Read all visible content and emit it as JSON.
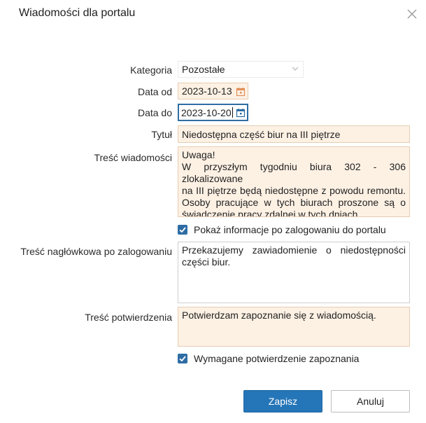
{
  "dialog": {
    "title": "Wiadomości dla portalu"
  },
  "form": {
    "kategoria": {
      "label": "Kategoria",
      "value": "Pozostałe"
    },
    "data_od": {
      "label": "Data od",
      "value": "2023-10-13"
    },
    "data_do": {
      "label": "Data do",
      "value": "2023-10-20"
    },
    "tytul": {
      "label": "Tytuł",
      "value": "Niedostępna część biur na III piętrze"
    },
    "tresc_wiadomosci": {
      "label": "Treść wiadomości",
      "lines": [
        "Uwaga!",
        "W przyszłym tygodniu biura 302 - 306 zlokalizowane",
        "na III piętrze będą niedostępne z powodu remontu.",
        "Osoby pracujące w tych biurach proszone są o",
        "świadczenie pracy zdalnej w tych dniach."
      ]
    },
    "pokaz_informacje": {
      "label": "Pokaż informacje po zalogowaniu do portalu",
      "checked": true
    },
    "tresc_naglowkowa": {
      "label": "Treść nagłówkowa po zalogowaniu",
      "lines": [
        "Przekazujemy zawiadomienie o niedostępności",
        "części biur."
      ]
    },
    "tresc_potwierdzenia": {
      "label": "Treść potwierdzenia",
      "value": "Potwierdzam zapoznanie się z wiadomością."
    },
    "wymagane_potwierdzenie": {
      "label": "Wymagane potwierdzenie zapoznania",
      "checked": true
    }
  },
  "buttons": {
    "save": "Zapisz",
    "cancel": "Anuluj"
  },
  "colors": {
    "accent": "#2576b8",
    "field_bg": "#fdf1e4",
    "field_border": "#e6cdb2"
  },
  "icons": {
    "close": "close-icon",
    "calendar": "calendar-icon",
    "dropdown": "chevron-down-icon",
    "check": "check-icon"
  }
}
